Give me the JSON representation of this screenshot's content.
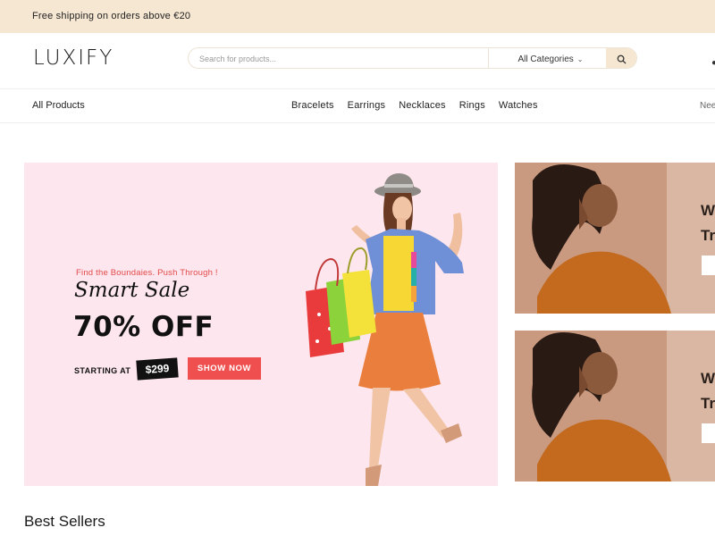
{
  "topbar": {
    "shipping_text": "Free shipping on orders above €20"
  },
  "header": {
    "logo": "LUXIFY",
    "search": {
      "placeholder": "Search for products...",
      "category": "All Categories"
    }
  },
  "nav": {
    "all_products": "All Products",
    "items": [
      "Bracelets",
      "Earrings",
      "Necklaces",
      "Rings",
      "Watches"
    ],
    "help_partial": "Nee"
  },
  "hero": {
    "tagline": "Find the Boundaies. Push Through !",
    "title": "Smart Sale",
    "discount": "70% OFF",
    "starting_label": "STARTING AT",
    "price": "$299",
    "cta": "SHOW NOW"
  },
  "side_banners": [
    {
      "line1": "W",
      "line2": "Tr"
    },
    {
      "line1": "W",
      "line2": "Tr"
    }
  ],
  "section": {
    "best_sellers": "Best Sellers"
  },
  "colors": {
    "topbar": "#f6e7d2",
    "hero_bg": "#fde6ed",
    "accent": "#f04f4f"
  }
}
